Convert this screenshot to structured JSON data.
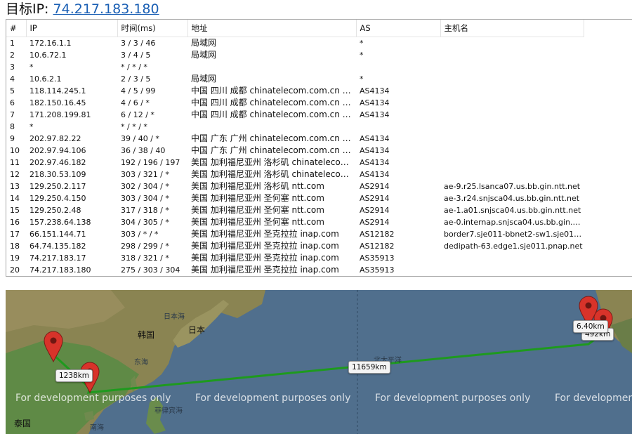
{
  "header": {
    "label": "目标IP:",
    "target_ip": "74.217.183.180"
  },
  "table": {
    "columns": [
      "#",
      "IP",
      "时间(ms)",
      "地址",
      "AS",
      "主机名"
    ],
    "rows": [
      [
        "1",
        "172.16.1.1",
        "3 / 3 / 46",
        "局域网",
        "*",
        ""
      ],
      [
        "2",
        "10.6.72.1",
        "3 / 4 / 5",
        "局域网",
        "*",
        ""
      ],
      [
        "3",
        "*",
        "* / * / *",
        "",
        "",
        ""
      ],
      [
        "4",
        "10.6.2.1",
        "2 / 3 / 5",
        "局域网",
        "*",
        ""
      ],
      [
        "5",
        "118.114.245.1",
        "4 / 5 / 99",
        "中国 四川 成都 chinatelecom.com.cn 电信",
        "AS4134",
        ""
      ],
      [
        "6",
        "182.150.16.45",
        "4 / 6 / *",
        "中国 四川 成都 chinatelecom.com.cn 电信",
        "AS4134",
        ""
      ],
      [
        "7",
        "171.208.199.81",
        "6 / 12 / *",
        "中国 四川 成都 chinatelecom.com.cn 电信",
        "AS4134",
        ""
      ],
      [
        "8",
        "*",
        "* / * / *",
        "",
        "",
        ""
      ],
      [
        "9",
        "202.97.82.22",
        "39 / 40 / *",
        "中国 广东 广州 chinatelecom.com.cn 电信",
        "AS4134",
        ""
      ],
      [
        "10",
        "202.97.94.106",
        "36 / 38 / 40",
        "中国 广东 广州 chinatelecom.com.cn 电信",
        "AS4134",
        ""
      ],
      [
        "11",
        "202.97.46.182",
        "192 / 196 / 197",
        "美国 加利福尼亚州 洛杉矶 chinatelecom.c...",
        "AS4134",
        ""
      ],
      [
        "12",
        "218.30.53.109",
        "303 / 321 / *",
        "美国 加利福尼亚州 洛杉矶 chinatelecom.c...",
        "AS4134",
        ""
      ],
      [
        "13",
        "129.250.2.117",
        "302 / 304 / *",
        "美国 加利福尼亚州 洛杉矶 ntt.com",
        "AS2914",
        "ae-9.r25.lsanca07.us.bb.gin.ntt.net"
      ],
      [
        "14",
        "129.250.4.150",
        "303 / 304 / *",
        "美国 加利福尼亚州 圣何塞 ntt.com",
        "AS2914",
        "ae-3.r24.snjsca04.us.bb.gin.ntt.net"
      ],
      [
        "15",
        "129.250.2.48",
        "317 / 318 / *",
        "美国 加利福尼亚州 圣何塞 ntt.com",
        "AS2914",
        "ae-1.a01.snjsca04.us.bb.gin.ntt.net"
      ],
      [
        "16",
        "157.238.64.138",
        "304 / 305 / *",
        "美国 加利福尼亚州 圣何塞 ntt.com",
        "AS2914",
        "ae-0.internap.snjsca04.us.bb.gin.nt..."
      ],
      [
        "17",
        "66.151.144.71",
        "303 / * / *",
        "美国 加利福尼亚州 圣克拉拉 inap.com",
        "AS12182",
        "border7.sje011-bbnet2-sw1.sje011...."
      ],
      [
        "18",
        "64.74.135.182",
        "298 / 299 / *",
        "美国 加利福尼亚州 圣克拉拉 inap.com",
        "AS12182",
        "dedipath-63.edge1.sje011.pnap.net"
      ],
      [
        "19",
        "74.217.183.17",
        "318 / 321 / *",
        "美国 加利福尼亚州 圣克拉拉 inap.com",
        "AS35913",
        ""
      ],
      [
        "20",
        "74.217.183.180",
        "275 / 303 / 304",
        "美国 加利福尼亚州 圣克拉拉 inap.com",
        "AS35913",
        ""
      ]
    ]
  },
  "map": {
    "labels": [
      "日本海",
      "韩国",
      "日本",
      "东海",
      "北太平洋",
      "菲律宾海",
      "南海",
      "泰国"
    ],
    "watermark": "For development purposes only",
    "distances": [
      "1238km",
      "11659km",
      "6.40km",
      "492km"
    ],
    "route_color": "#1e9a1e",
    "marker_color": "#d8332a"
  }
}
